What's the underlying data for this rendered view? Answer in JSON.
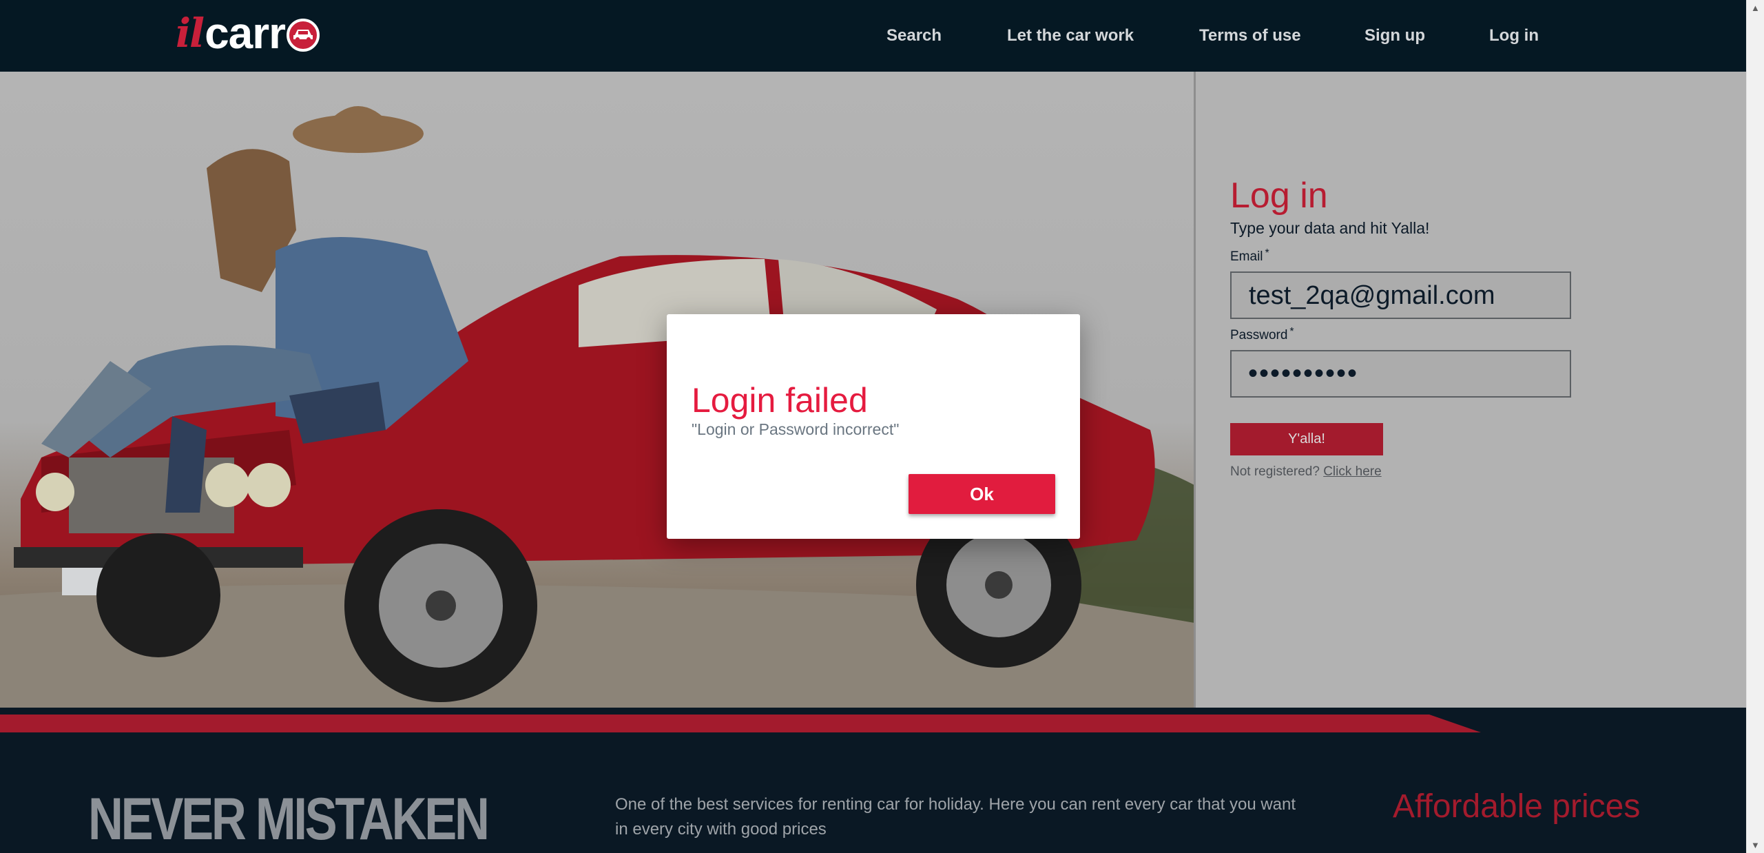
{
  "header": {
    "logo_il": "il",
    "logo_carr": "carr",
    "nav": [
      {
        "label": "Search"
      },
      {
        "label": "Let the car work"
      },
      {
        "label": "Terms of use"
      },
      {
        "label": "Sign up"
      },
      {
        "label": "Log in"
      }
    ]
  },
  "login": {
    "title": "Log in",
    "subtitle": "Type your data and hit Yalla!",
    "email_label": "Email",
    "email_value": "test_2qa@gmail.com",
    "password_label": "Password",
    "password_value": "••••••••••",
    "required_mark": "*",
    "submit_label": "Y'alla!",
    "not_registered": "Not registered?",
    "click_here": "Click here"
  },
  "footer": {
    "headline": "NEVER MISTAKEN",
    "blurb": "One of the best services for renting car for holiday. Here you can rent every car that you want in every city with good prices",
    "affordable": "Affordable prices"
  },
  "dialog": {
    "title": "Login failed",
    "message": "\"Login or Password incorrect\"",
    "ok_label": "Ok"
  },
  "colors": {
    "header_bg": "#051823",
    "brand_red": "#c8203a",
    "dialog_red": "#e11c3e",
    "panel_bg": "#b2b2b2"
  }
}
